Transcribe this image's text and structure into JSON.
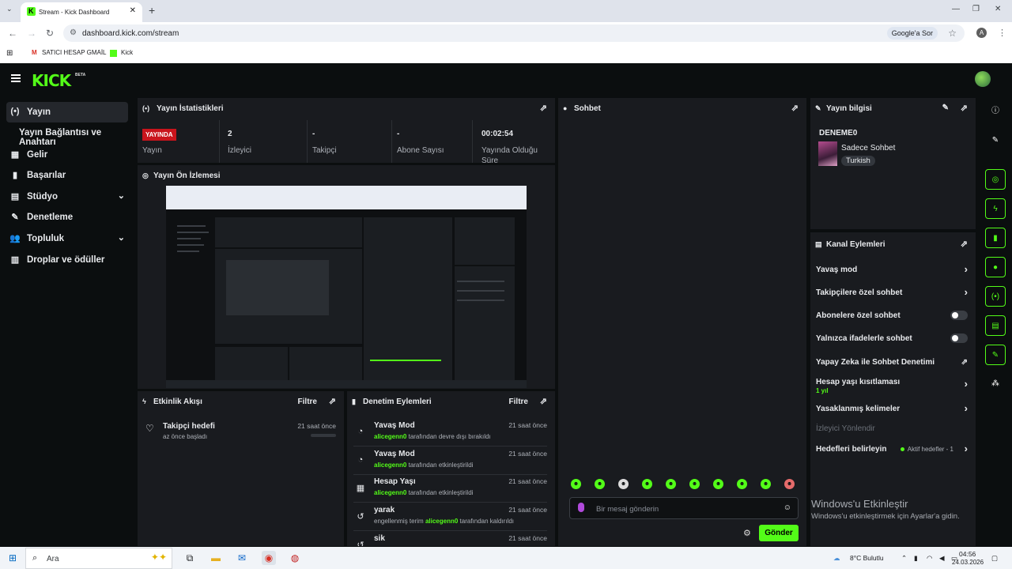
{
  "browser": {
    "tab_title": "Stream - Kick Dashboard",
    "url": "dashboard.kick.com/stream",
    "google_sor": "Google'a Sor",
    "profile_initial": "A",
    "bookmarks": [
      "SATICI HESAP GMAİL",
      "Kick"
    ]
  },
  "app": {
    "logo": "KICK",
    "beta": "BETA"
  },
  "sidebar": {
    "items": [
      {
        "label": "Yayın",
        "icon": "broadcast-icon"
      },
      {
        "label": "Yayın Bağlantısı ve Anahtarı"
      },
      {
        "label": "Gelir",
        "icon": "dollar-icon"
      },
      {
        "label": "Başarılar",
        "icon": "trophy-icon"
      },
      {
        "label": "Stüdyo",
        "icon": "grid-icon"
      },
      {
        "label": "Denetleme",
        "icon": "wrench-icon"
      },
      {
        "label": "Topluluk",
        "icon": "users-icon"
      },
      {
        "label": "Droplar ve ödüller",
        "icon": "gift-icon"
      }
    ]
  },
  "stats": {
    "title": "Yayın İstatistikleri",
    "live_badge": "YAYINDA",
    "items": [
      {
        "value": "",
        "label": "Yayın"
      },
      {
        "value": "2",
        "label": "İzleyici"
      },
      {
        "value": "-",
        "label": "Takipçi"
      },
      {
        "value": "-",
        "label": "Abone Sayısı"
      },
      {
        "value": "00:02:54",
        "label": "Yayında Olduğu Süre"
      }
    ]
  },
  "preview": {
    "title": "Yayın Ön İzlemesi"
  },
  "activity": {
    "title": "Etkinlik Akışı",
    "filter": "Filtre",
    "rows": [
      {
        "title": "Takipçi hedefi",
        "sub": "az önce başladı",
        "time": "21 saat önce"
      }
    ]
  },
  "moderation": {
    "title": "Denetim Eylemleri",
    "filter": "Filtre",
    "rows": [
      {
        "title": "Yavaş Mod",
        "user": "alicegenn0",
        "rest": "tarafından devre dışı bırakıldı",
        "time": "21 saat önce"
      },
      {
        "title": "Yavaş Mod",
        "user": "alicegenn0",
        "rest": "tarafından etkinleştirildi",
        "time": "21 saat önce"
      },
      {
        "title": "Hesap Yaşı",
        "user": "alicegenn0",
        "rest": "tarafından etkinleştirildi",
        "time": "21 saat önce"
      },
      {
        "title": "yarak",
        "pre": "engellenmiş terim",
        "user": "alicegenn0",
        "rest": "tarafından kaldırıldı",
        "time": "21 saat önce"
      },
      {
        "title": "sik",
        "time": "21 saat önce"
      }
    ]
  },
  "chat": {
    "title": "Sohbet",
    "placeholder": "Bir mesaj gönderin",
    "send": "Gönder"
  },
  "stream_info": {
    "title": "Yayın bilgisi",
    "stream_name": "DENEME0",
    "category": "Sadece Sohbet",
    "tag": "Turkish"
  },
  "channel_actions": {
    "title": "Kanal Eylemleri",
    "rows": [
      {
        "label": "Yavaş mod"
      },
      {
        "label": "Takipçilere özel sohbet"
      },
      {
        "label": "Abonelere özel sohbet"
      },
      {
        "label": "Yalnızca ifadelerle sohbet"
      },
      {
        "label": "Yapay Zeka ile Sohbet Denetimi"
      },
      {
        "label": "Hesap yaşı kısıtlaması",
        "sub": "1 yıl"
      },
      {
        "label": "Yasaklanmış kelimeler"
      },
      {
        "label": "İzleyici Yönlendir"
      },
      {
        "label": "Hedefleri belirleyin",
        "note": "Aktif hedefler - 1"
      }
    ]
  },
  "watermark": {
    "line1": "Windows'u Etkinleştir",
    "line2": "Windows'u etkinleştirmek için Ayarlar'a gidin."
  },
  "taskbar": {
    "search": "Ara",
    "weather": "8°C  Bulutlu",
    "time": "04:56",
    "date": "24.03.2026"
  }
}
